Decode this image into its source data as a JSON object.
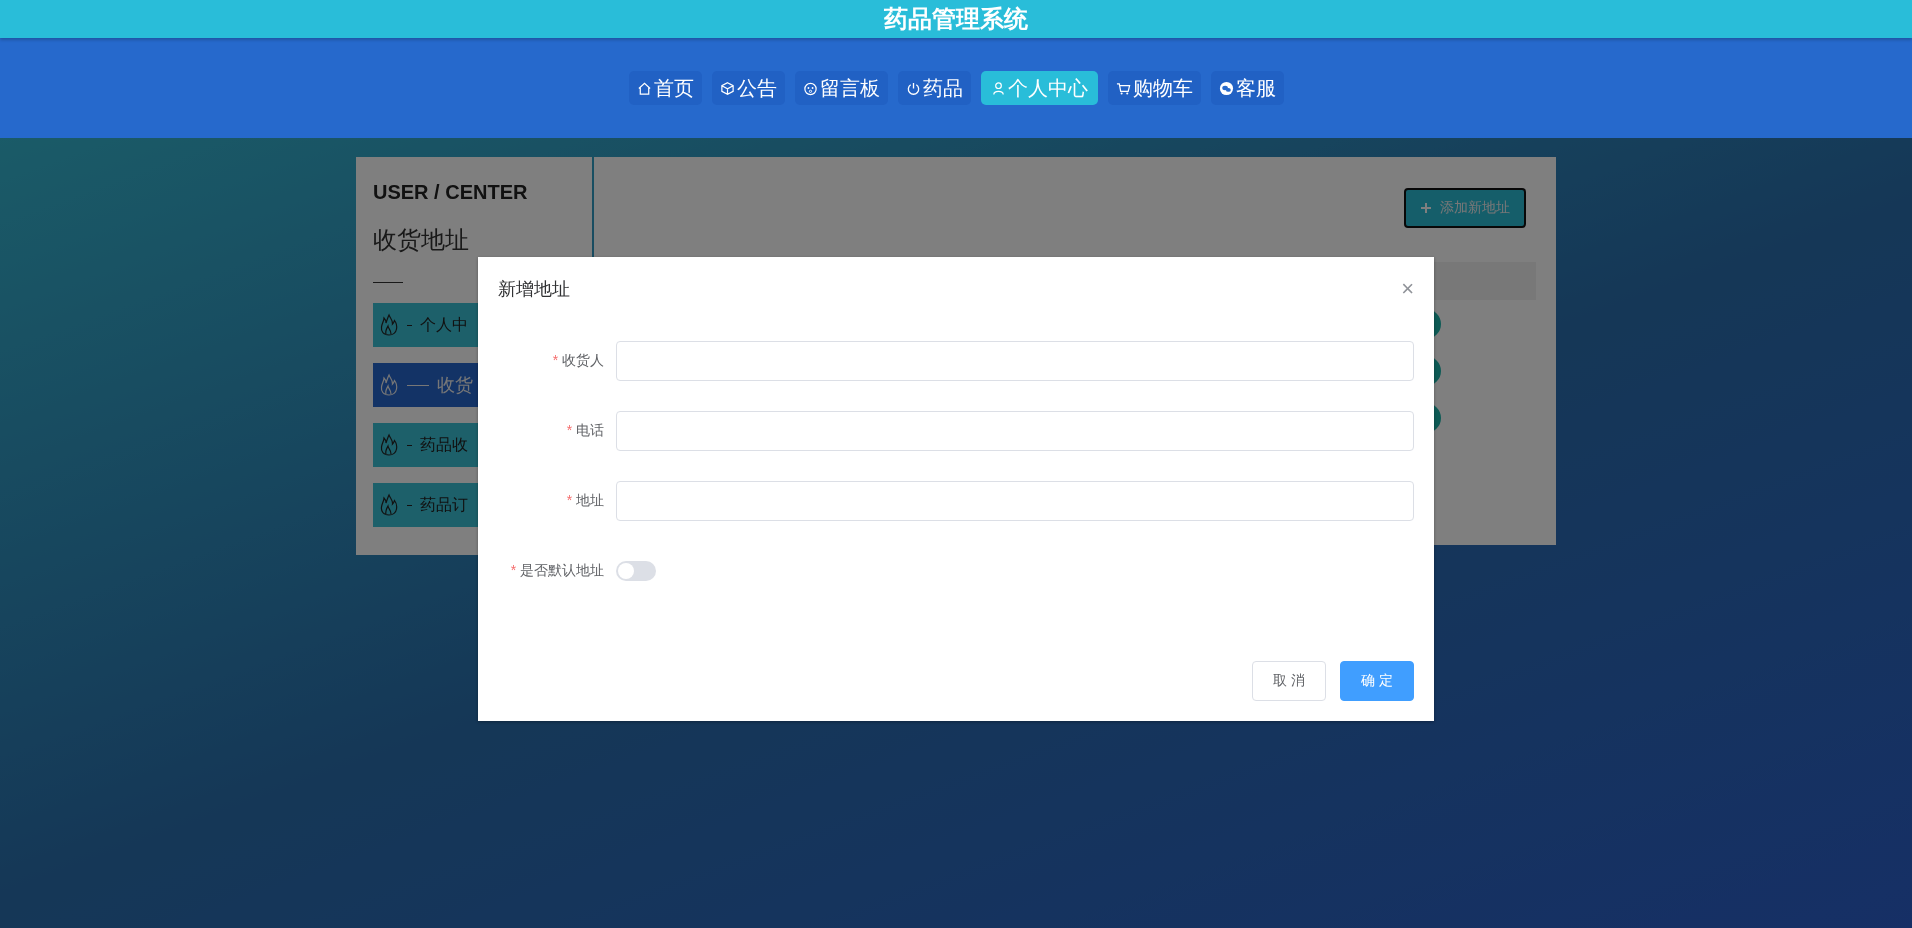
{
  "app_title": "药品管理系统",
  "nav": [
    {
      "label": "首页",
      "selected": false
    },
    {
      "label": "公告",
      "selected": false
    },
    {
      "label": "留言板",
      "selected": false
    },
    {
      "label": "药品",
      "selected": false
    },
    {
      "label": "个人中心",
      "selected": true
    },
    {
      "label": "购物车",
      "selected": false
    },
    {
      "label": "客服",
      "selected": false
    }
  ],
  "sidebar": {
    "heading": "USER / CENTER",
    "title": "收货地址",
    "items": [
      {
        "label": "个人中",
        "selected": false
      },
      {
        "label": "收货",
        "selected": true
      },
      {
        "label": "药品收",
        "selected": false
      },
      {
        "label": "药品订",
        "selected": false
      }
    ]
  },
  "content": {
    "add_button": "添加新地址"
  },
  "dialog": {
    "title": "新增地址",
    "close": "×",
    "fields": [
      {
        "kind": "input",
        "label": "收货人",
        "required_mark": "*"
      },
      {
        "kind": "input",
        "label": "电话",
        "required_mark": "*"
      },
      {
        "kind": "input",
        "label": "地址",
        "required_mark": "*"
      },
      {
        "kind": "switch",
        "label": "是否默认地址",
        "required_mark": "*",
        "on": false
      }
    ],
    "buttons": [
      {
        "label": "取 消",
        "kind": "default"
      },
      {
        "label": "确 定",
        "kind": "primary"
      }
    ]
  }
}
